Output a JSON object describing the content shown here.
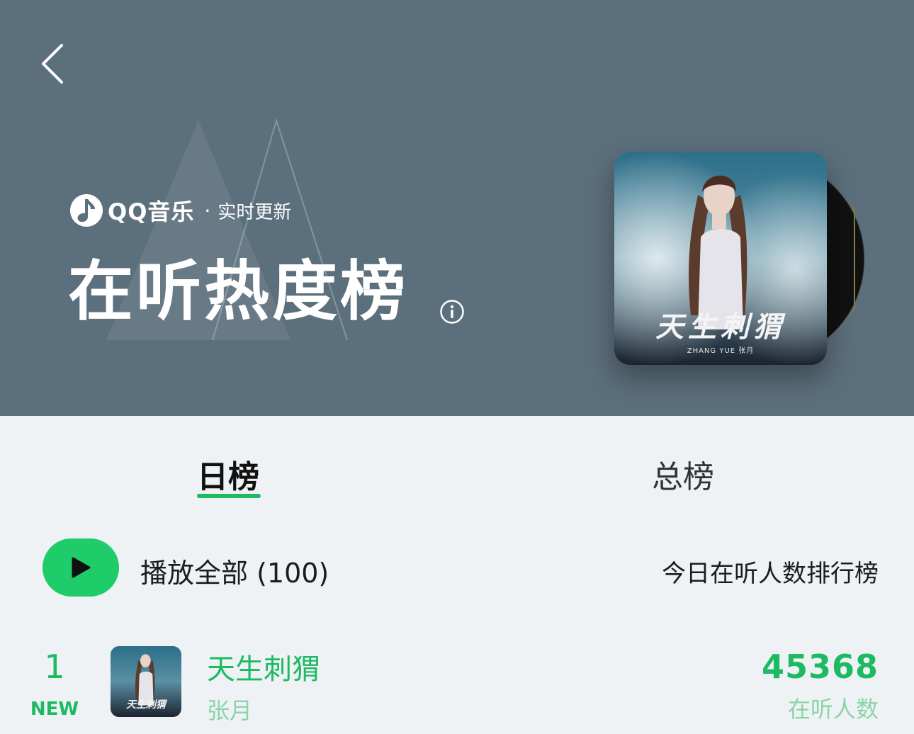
{
  "header": {
    "back_icon": "chevron-left-icon",
    "brand_name": "QQ音乐",
    "brand_separator": "·",
    "brand_sub": "实时更新",
    "title": "在听热度榜",
    "info_icon": "info-icon",
    "cover": {
      "title": "天生刺猬",
      "subtitle": "ZHANG YUE 张月"
    }
  },
  "tabs": [
    {
      "label": "日榜",
      "active": true
    },
    {
      "label": "总榜",
      "active": false
    }
  ],
  "play_all": {
    "icon": "play-icon",
    "label": "播放全部 (100)"
  },
  "rank_description": "今日在听人数排行榜",
  "songs": [
    {
      "rank": "1",
      "badge": "NEW",
      "title": "天生刺猬",
      "artist": "张月",
      "cover_title": "天生刺猬",
      "listeners": "45368",
      "listeners_label": "在听人数"
    }
  ],
  "colors": {
    "hero_bg": "#5c6f7c",
    "page_bg": "#eef2f5",
    "accent": "#1dba63",
    "accent_light": "#8ad4a8"
  }
}
